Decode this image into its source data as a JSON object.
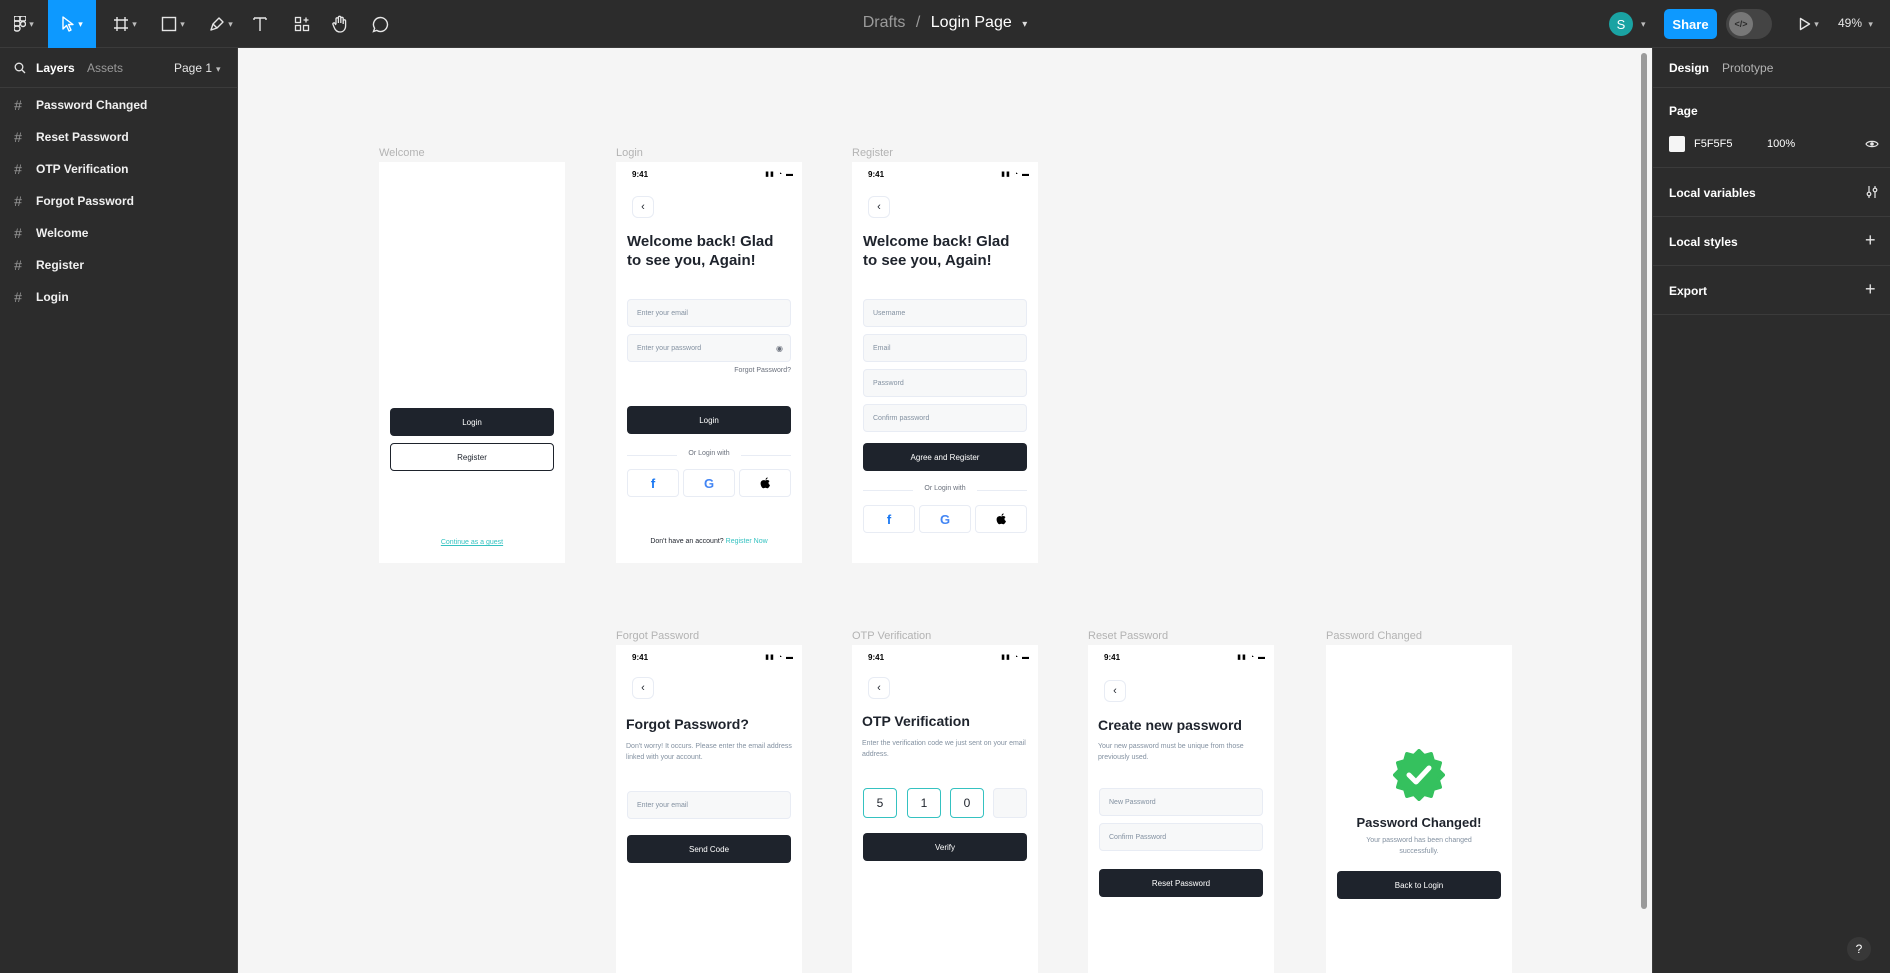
{
  "toolbar": {
    "breadcrumb_parent": "Drafts",
    "breadcrumb_sep": "/",
    "file_name": "Login Page",
    "avatar_initial": "S",
    "share_label": "Share",
    "zoom": "49%",
    "accent": "#0d99ff"
  },
  "left_panel": {
    "tab_layers": "Layers",
    "tab_assets": "Assets",
    "page_selector": "Page 1",
    "layers": [
      "Password Changed",
      "Reset Password",
      "OTP Verification",
      "Forgot Password",
      "Welcome",
      "Register",
      "Login"
    ]
  },
  "right_panel": {
    "tab_design": "Design",
    "tab_prototype": "Prototype",
    "page_heading": "Page",
    "page_color": "F5F5F5",
    "page_opacity": "100%",
    "local_variables": "Local variables",
    "local_styles": "Local styles",
    "export": "Export",
    "help": "?"
  },
  "frames": {
    "welcome": {
      "label": "Welcome",
      "login": "Login",
      "register": "Register",
      "guest": "Continue as a guest"
    },
    "login": {
      "label": "Login",
      "time": "9:41",
      "heading1": "Welcome back! Glad",
      "heading2": "to see you, Again!",
      "email_ph": "Enter your email",
      "password_ph": "Enter your password",
      "forgot": "Forgot Password?",
      "button": "Login",
      "or": "Or Login with",
      "no_account": "Don't have an account?",
      "register_now": "Register Now"
    },
    "register": {
      "label": "Register",
      "time": "9:41",
      "heading1": "Welcome back! Glad",
      "heading2": "to see you, Again!",
      "username_ph": "Username",
      "email_ph": "Email",
      "password_ph": "Password",
      "confirm_ph": "Confirm password",
      "button": "Agree and Register",
      "or": "Or Login with"
    },
    "forgot": {
      "label": "Forgot Password",
      "time": "9:41",
      "heading": "Forgot Password?",
      "sub": "Don't worry! It occurs. Please enter the email address linked with your account.",
      "email_ph": "Enter your email",
      "button": "Send Code"
    },
    "otp": {
      "label": "OTP Verification",
      "time": "9:41",
      "heading": "OTP Verification",
      "sub": "Enter the verification code we just sent on your email address.",
      "digits": [
        "5",
        "1",
        "0",
        ""
      ],
      "button": "Verify"
    },
    "reset": {
      "label": "Reset Password",
      "time": "9:41",
      "heading": "Create new password",
      "sub": "Your new password must be unique from those previously used.",
      "new_ph": "New Password",
      "confirm_ph": "Confirm Password",
      "button": "Reset Password"
    },
    "changed": {
      "label": "Password Changed",
      "heading": "Password Changed!",
      "sub": "Your password has been changed successfully.",
      "button": "Back to Login",
      "badge_color": "#35c15e"
    }
  },
  "colors": {
    "teal": "#35c2c1",
    "dark": "#1e232c",
    "facebook": "#1877f2"
  }
}
